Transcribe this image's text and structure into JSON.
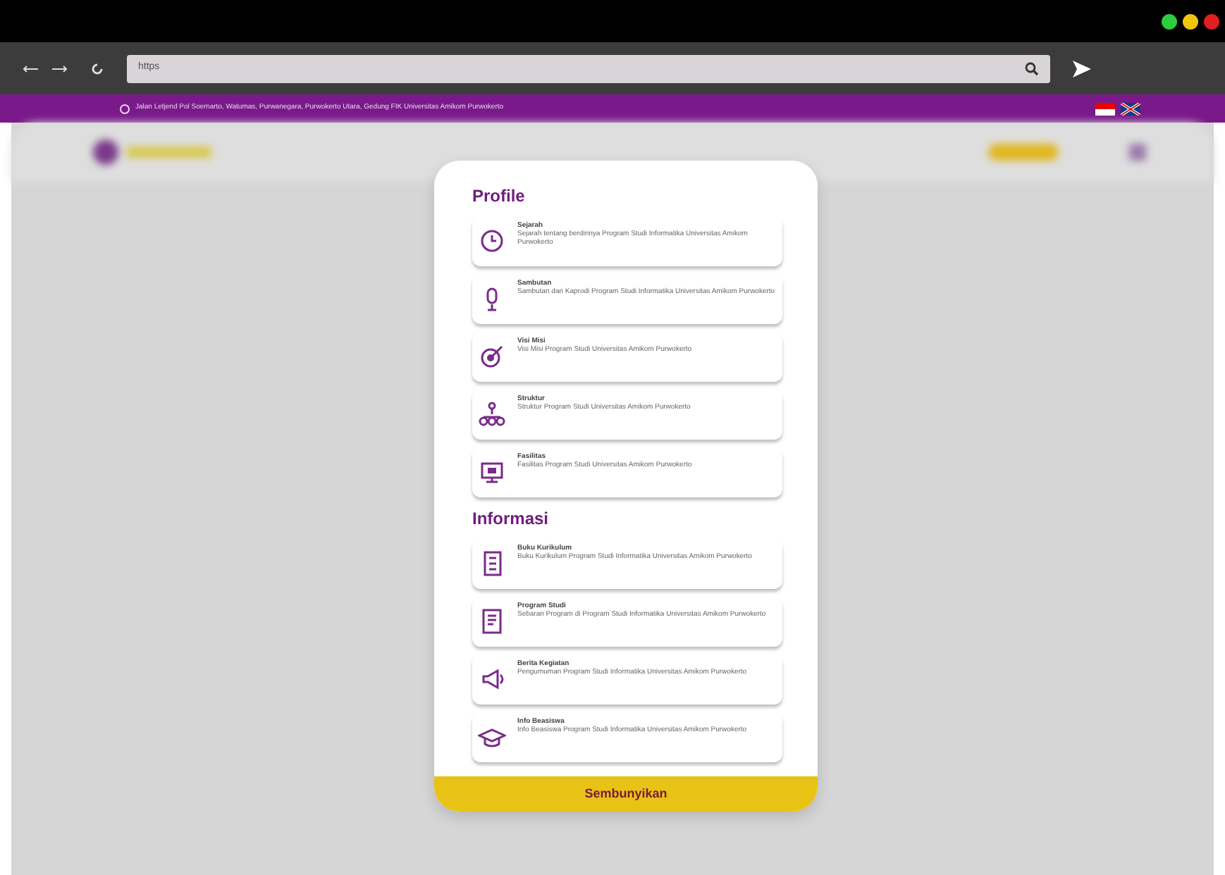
{
  "browser": {
    "url": "https"
  },
  "info_bar": {
    "address": "Jalan Letjend Pol Soemarto, Watumas, Purwanegara, Purwokerto Utara, Gedung FIK Universitas Amikom Purwokerto"
  },
  "menu": {
    "sections": [
      {
        "title": "Profile",
        "items": [
          {
            "kind": "clock",
            "title": "Sejarah",
            "description": "Sejarah tentang berdirinya Program Studi Informatika Universitas Amikom Purwokerto"
          },
          {
            "kind": "mic",
            "title": "Sambutan",
            "description": "Sambutan dari Kaprodi Program Studi Informatika Universitas Amikom Purwokerto"
          },
          {
            "kind": "target",
            "title": "Visi Misi",
            "description": "Visi Misi Program Studi Universitas Amikom Purwokerto"
          },
          {
            "kind": "org",
            "title": "Struktur",
            "description": "Struktur Program Studi Universitas Amikom Purwokerto"
          },
          {
            "kind": "monitor",
            "title": "Fasilitas",
            "description": "Fasilitas Program Studi Universitas Amikom Purwokerto"
          }
        ]
      },
      {
        "title": "Informasi",
        "items": [
          {
            "kind": "book",
            "title": "Buku Kurikulum",
            "description": "Buku Kurikulum Program Studi Informatika Universitas Amikom Purwokerto"
          },
          {
            "kind": "doc",
            "title": "Program Studi",
            "description": "Sebaran Program di Program Studi Informatika Universitas Amikom Purwokerto"
          },
          {
            "kind": "megaphone",
            "title": "Berita Kegiatan",
            "description": "Pengumuman Program Studi Informatika Universitas Amikom Purwokerto"
          },
          {
            "kind": "cap",
            "title": "Info Beasiswa",
            "description": "Info Beasiswa Program Studi Informatika Universitas Amikom Purwokerto"
          }
        ]
      }
    ],
    "hide_button": "Sembunyikan"
  }
}
